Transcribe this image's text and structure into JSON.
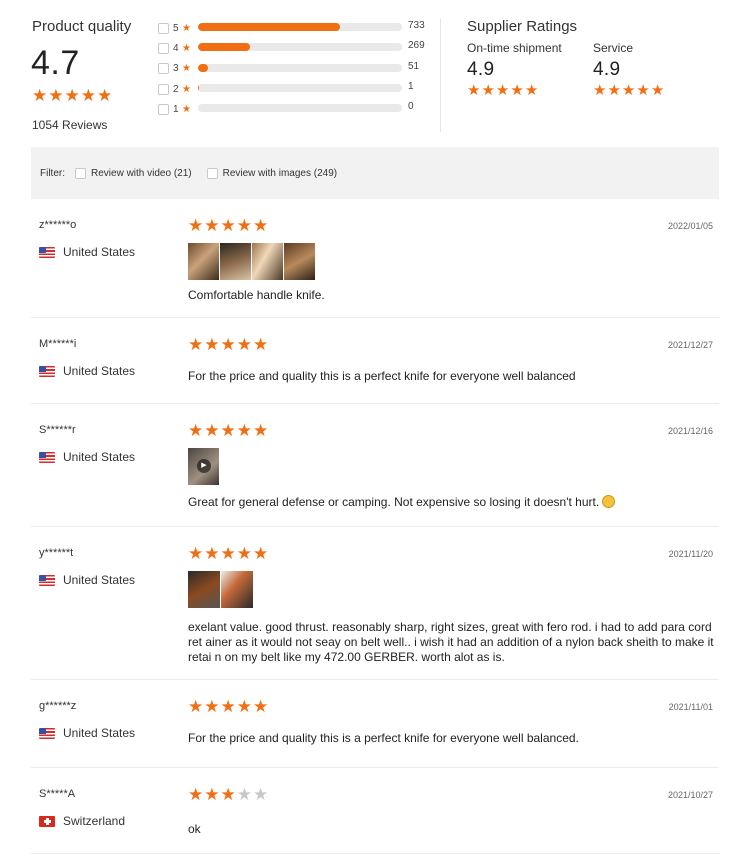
{
  "product_quality": {
    "title": "Product quality",
    "score": "4.7",
    "stars": 5,
    "review_count": "1054 Reviews",
    "breakdown": [
      {
        "rating": "5",
        "count": "733",
        "fraction": 0.695
      },
      {
        "rating": "4",
        "count": "269",
        "fraction": 0.255
      },
      {
        "rating": "3",
        "count": "51",
        "fraction": 0.048
      },
      {
        "rating": "2",
        "count": "1",
        "fraction": 0.001
      },
      {
        "rating": "1",
        "count": "0",
        "fraction": 0.0
      }
    ]
  },
  "supplier_ratings": {
    "title": "Supplier Ratings",
    "shipment_label": "On-time shipment",
    "shipment_score": "4.9",
    "service_label": "Service",
    "service_score": "4.9"
  },
  "filter": {
    "label": "Filter:",
    "video_label": "Review with video (21)",
    "images_label": "Review with images (249)"
  },
  "reviews": [
    {
      "user": "z******o",
      "country": "United States",
      "flag": "us",
      "stars": 5,
      "date": "2022/01/05",
      "text": "Comfortable handle knife.",
      "media": [
        "photo",
        "photo",
        "photo",
        "photo"
      ]
    },
    {
      "user": "M******i",
      "country": "United States",
      "flag": "us",
      "stars": 5,
      "date": "2021/12/27",
      "text": "For the price and quality this is a perfect knife for everyone well balanced",
      "media": []
    },
    {
      "user": "S******r",
      "country": "United States",
      "flag": "us",
      "stars": 5,
      "date": "2021/12/16",
      "text": "Great for general defense or camping. Not expensive so losing it doesn't hurt.",
      "media": [
        "video"
      ]
    },
    {
      "user": "y******t",
      "country": "United States",
      "flag": "us",
      "stars": 5,
      "date": "2021/11/20",
      "text": "exelant value. good thrust. reasonably sharp, right sizes, great with fero rod. i had to add para cord ret ainer as it would not seay on belt well.. i wish it had an addition of a nylon back sheith to make it retai n on my belt like my 472.00 GERBER. worth alot as is.",
      "media": [
        "photo",
        "photo"
      ]
    },
    {
      "user": "g******z",
      "country": "United States",
      "flag": "us",
      "stars": 5,
      "date": "2021/11/01",
      "text": "For the price and quality this is a perfect knife for everyone well balanced.",
      "media": []
    },
    {
      "user": "S*****A",
      "country": "Switzerland",
      "flag": "ch",
      "stars": 3,
      "date": "2021/10/27",
      "text": "ok",
      "media": []
    }
  ],
  "colors": {
    "accent": "#f26e12",
    "star_off": "#c8c8c8",
    "filter_bg": "#f2f2f2"
  }
}
